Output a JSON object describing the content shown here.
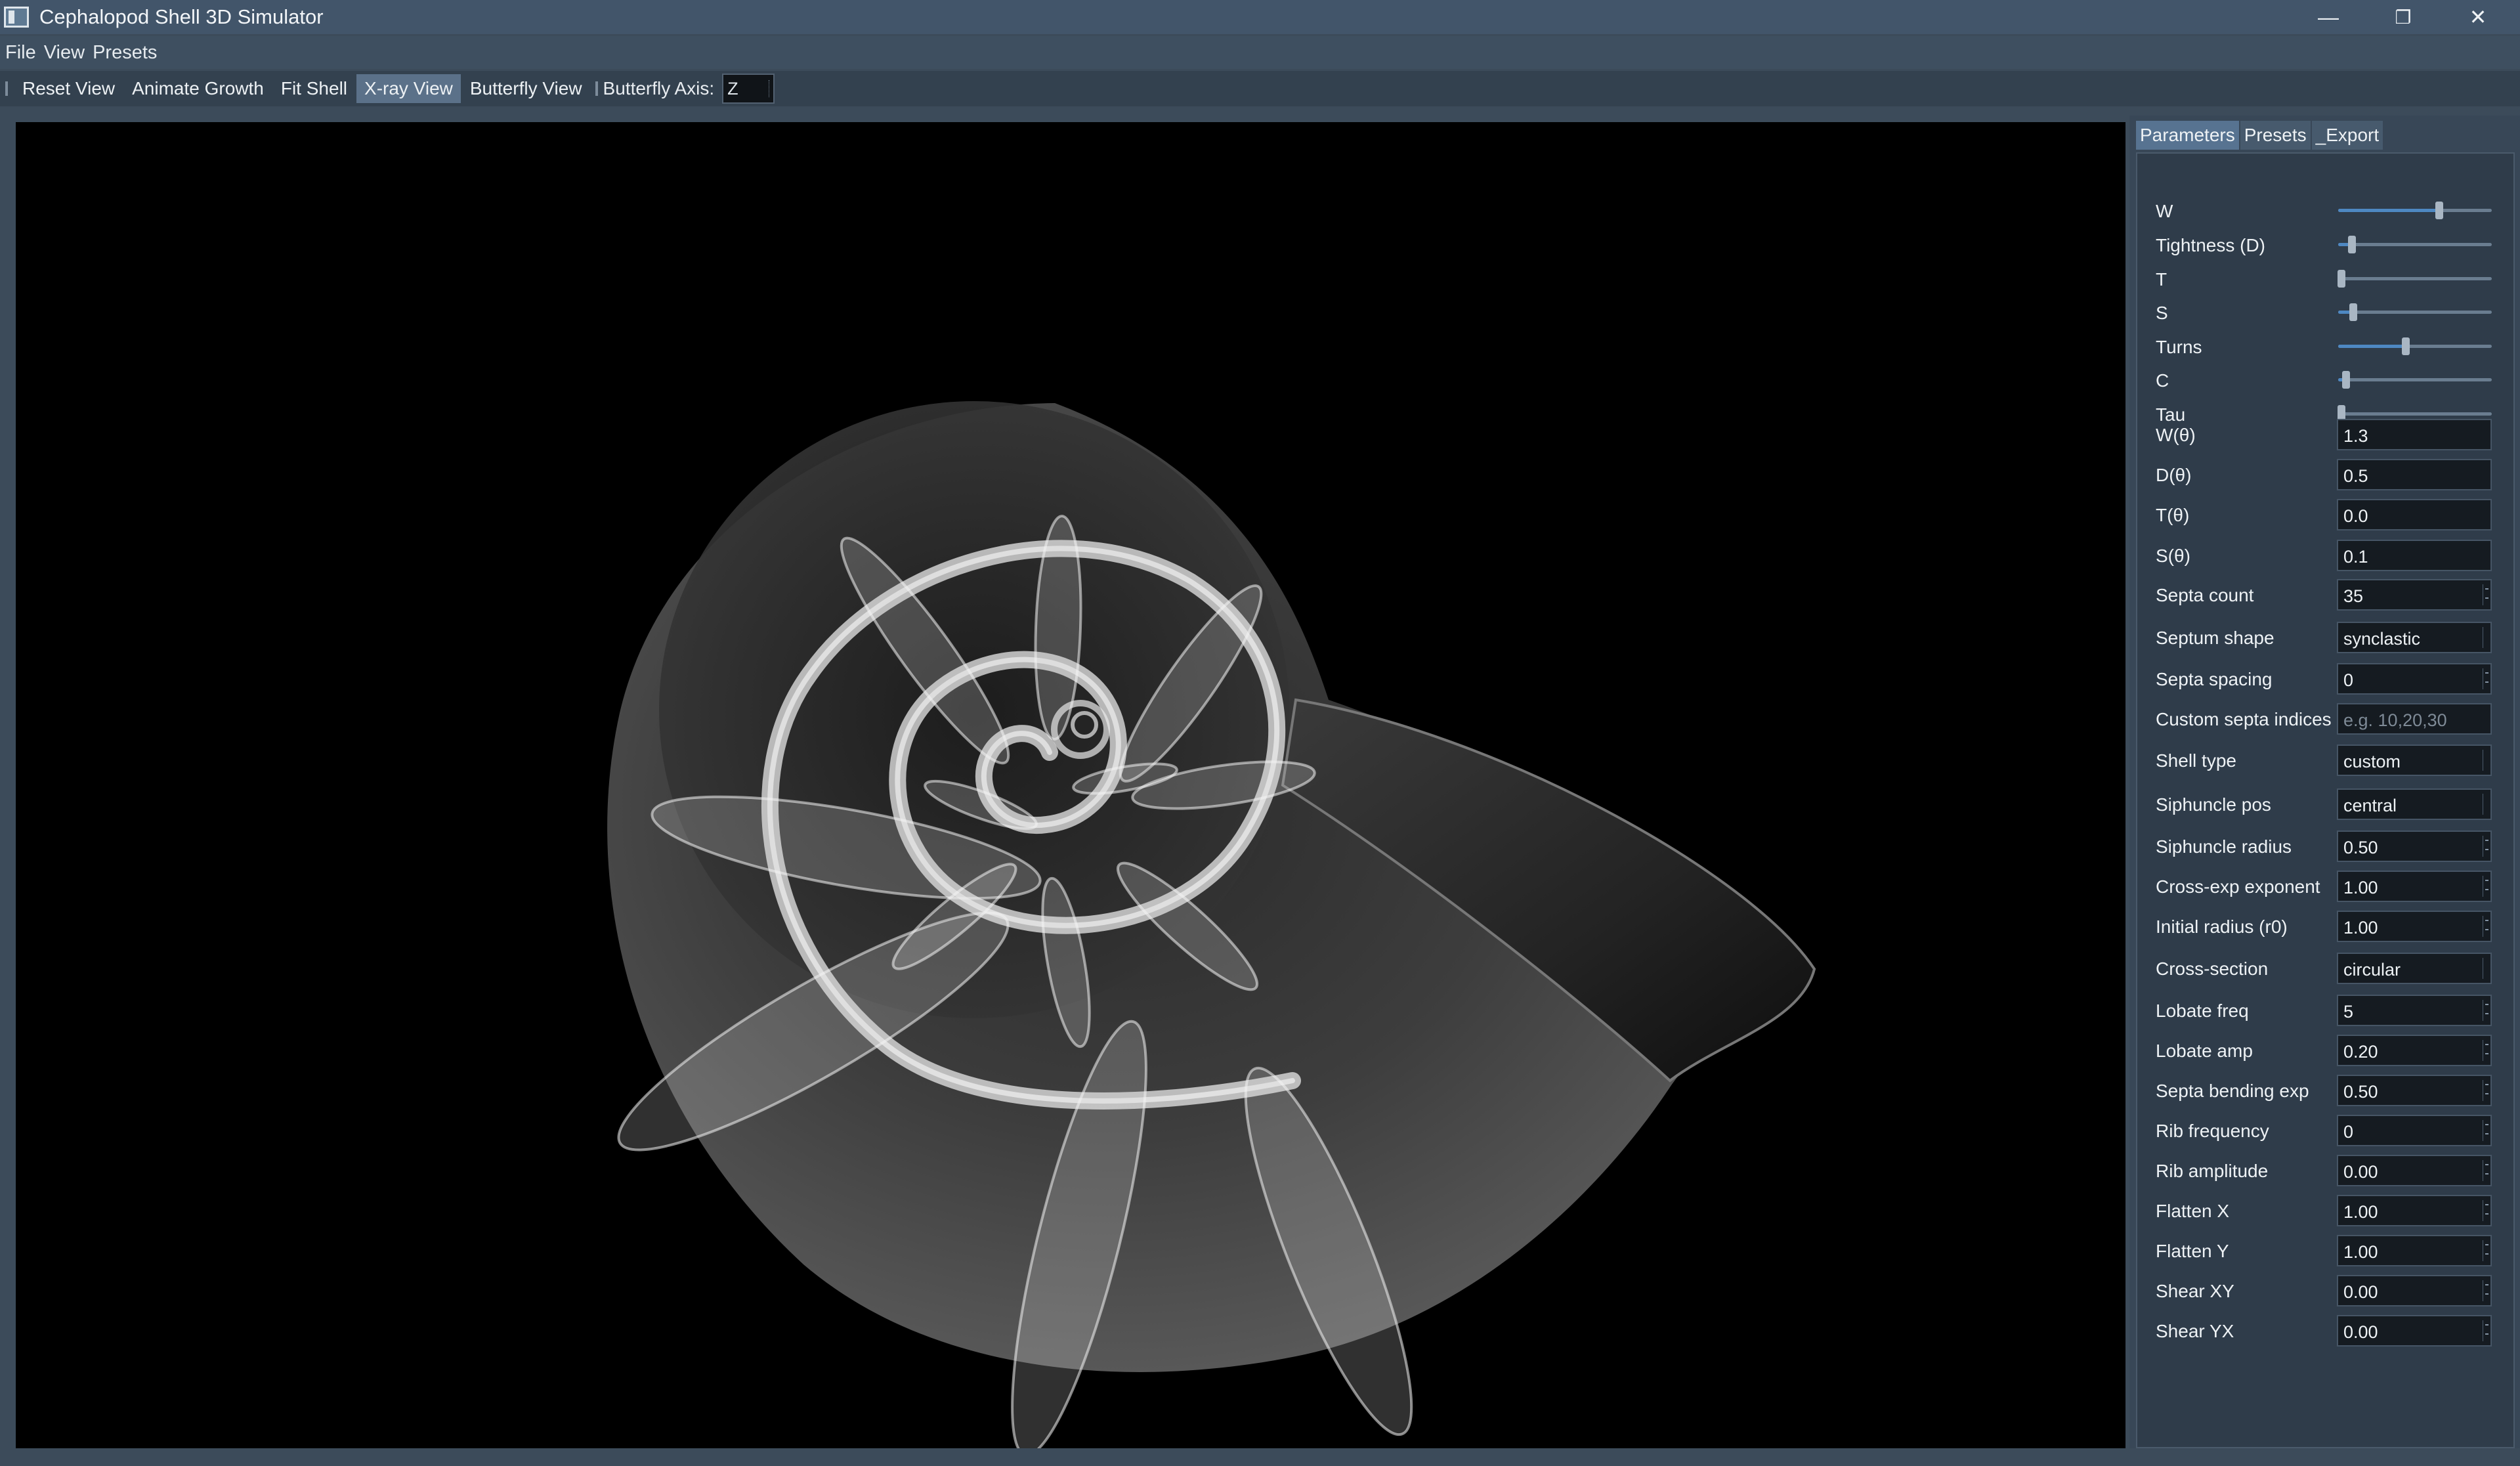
{
  "window": {
    "title": "Cephalopod Shell 3D Simulator",
    "controls": {
      "minimize": "—",
      "restore": "❐",
      "close": "✕"
    }
  },
  "menubar": {
    "items": [
      "File",
      "View",
      "Presets"
    ]
  },
  "toolbar": {
    "buttons": [
      "Reset View",
      "Animate Growth",
      "Fit Shell",
      "X-ray View",
      "Butterfly View"
    ],
    "active_button": "X-ray View",
    "axis_label": "Butterfly Axis:",
    "axis_value": "Z"
  },
  "tabs": [
    "Parameters",
    "Presets",
    "_Export"
  ],
  "active_tab": "Parameters",
  "sliders": [
    {
      "label": "W",
      "value": 0.66
    },
    {
      "label": "Tightness (D)",
      "value": 0.09
    },
    {
      "label": "T",
      "value": 0.02
    },
    {
      "label": "S",
      "value": 0.1
    },
    {
      "label": "Turns",
      "value": 0.44
    },
    {
      "label": "C",
      "value": 0.05
    },
    {
      "label": "Tau",
      "value": 0.02
    }
  ],
  "fields": [
    {
      "label": "W(θ)",
      "value": "1.3",
      "kind": "text"
    },
    {
      "label": "D(θ)",
      "value": "0.5",
      "kind": "text"
    },
    {
      "label": "T(θ)",
      "value": "0.0",
      "kind": "text"
    },
    {
      "label": "S(θ)",
      "value": "0.1",
      "kind": "text"
    },
    {
      "label": "Septa count",
      "value": "35",
      "kind": "spin"
    },
    {
      "label": "Septum shape",
      "value": "synclastic",
      "kind": "combo"
    },
    {
      "label": "Septa spacing",
      "value": "0",
      "kind": "spin"
    },
    {
      "label": "Custom septa indices",
      "value": "",
      "placeholder": "e.g. 10,20,30",
      "kind": "text"
    },
    {
      "label": "Shell type",
      "value": "custom",
      "kind": "combo"
    },
    {
      "label": "Siphuncle pos",
      "value": "central",
      "kind": "combo"
    },
    {
      "label": "Siphuncle radius",
      "value": "0.50",
      "kind": "spin"
    },
    {
      "label": "Cross-exp exponent",
      "value": "1.00",
      "kind": "spin"
    },
    {
      "label": "Initial radius (r0)",
      "value": "1.00",
      "kind": "spin"
    },
    {
      "label": "Cross-section",
      "value": "circular",
      "kind": "combo"
    },
    {
      "label": "Lobate freq",
      "value": "5",
      "kind": "spin"
    },
    {
      "label": "Lobate amp",
      "value": "0.20",
      "kind": "spin"
    },
    {
      "label": "Septa bending exp",
      "value": "0.50",
      "kind": "spin"
    },
    {
      "label": "Rib frequency",
      "value": "0",
      "kind": "spin"
    },
    {
      "label": "Rib amplitude",
      "value": "0.00",
      "kind": "spin"
    },
    {
      "label": "Flatten X",
      "value": "1.00",
      "kind": "spin"
    },
    {
      "label": "Flatten Y",
      "value": "1.00",
      "kind": "spin"
    },
    {
      "label": "Shear XY",
      "value": "0.00",
      "kind": "spin"
    },
    {
      "label": "Shear YX",
      "value": "0.00",
      "kind": "spin"
    }
  ],
  "colors": {
    "titlebar": "#42556a",
    "viewport_background": "#000000",
    "slider_fill": "#4e88c2",
    "active_button": "#5b7189"
  },
  "viewport": {
    "mode": "x-ray",
    "subject": "nautilus-like coiled shell with septa"
  }
}
